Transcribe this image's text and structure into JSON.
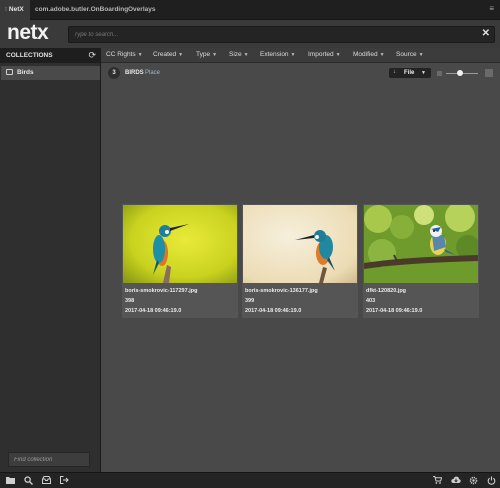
{
  "tabs": [
    {
      "label": "NetX",
      "grip": "⁝"
    },
    {
      "label": "com.adobe.butler.OnBoarding"
    },
    {
      "label": "Overlays"
    }
  ],
  "tab_menu_icon": "menu-icon",
  "header": {
    "logo": "netx",
    "search_placeholder": "Type to search...",
    "clear_icon": "✕"
  },
  "sidebar": {
    "title": "COLLECTIONS",
    "refresh_icon": "⟳",
    "items": [
      {
        "label": "Birds"
      }
    ],
    "find_placeholder": "Find collection"
  },
  "filters": [
    {
      "label": "CC Rights"
    },
    {
      "label": "Created"
    },
    {
      "label": "Type"
    },
    {
      "label": "Size"
    },
    {
      "label": "Extension"
    },
    {
      "label": "Imported"
    },
    {
      "label": "Modified"
    },
    {
      "label": "Source"
    }
  ],
  "toolbar": {
    "count": "3",
    "collection_name": "BIRDS",
    "place_link": "Place",
    "sort_value": "File",
    "sort_arrow": "↓"
  },
  "assets": [
    {
      "name": "boris-smokrovic-117297.jpg",
      "id": "398",
      "date": "2017-04-18 09:46:19.0"
    },
    {
      "name": "boris-smokrovic-136177.jpg",
      "id": "399",
      "date": "2017-04-18 09:46:19.0"
    },
    {
      "name": "dfkt-120820.jpg",
      "id": "403",
      "date": "2017-04-18 09:46:19.0"
    }
  ],
  "bottom_icons": {
    "left": [
      "folder-icon",
      "search-icon",
      "inbox-icon",
      "sign-out-icon"
    ],
    "right": [
      "cart-icon",
      "cloud-download-icon",
      "settings-icon",
      "power-icon"
    ]
  }
}
